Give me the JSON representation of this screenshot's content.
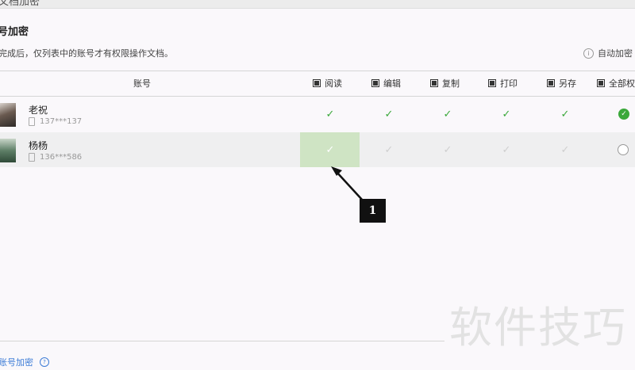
{
  "window": {
    "title": "文档加密"
  },
  "page": {
    "title": "号加密",
    "description": "完成后，仅列表中的账号才有权限操作文档。",
    "auto_encrypt_label": "自动加密"
  },
  "table": {
    "account_header": "账号",
    "columns": [
      "阅读",
      "编辑",
      "复制",
      "打印",
      "另存",
      "全部权"
    ],
    "rows": [
      {
        "name": "老祝",
        "phone": "137***137",
        "permissions": [
          true,
          true,
          true,
          true,
          true
        ],
        "all_selected": true
      },
      {
        "name": "杨杨",
        "phone": "136***586",
        "permissions": [
          true,
          false,
          false,
          false,
          false
        ],
        "all_selected": false
      }
    ]
  },
  "footer": {
    "add_account_label": "账号加密"
  },
  "annotation": {
    "callout_number": "1"
  },
  "watermark": {
    "text": "软件技巧"
  },
  "colors": {
    "accent_green": "#3aa83a",
    "highlight_green": "#cfe4c4",
    "link_blue": "#3c7bd6"
  },
  "icons": {
    "auto_encrypt": "info-icon",
    "phone": "phone-icon",
    "check": "check-icon",
    "footer_help": "question-icon"
  }
}
